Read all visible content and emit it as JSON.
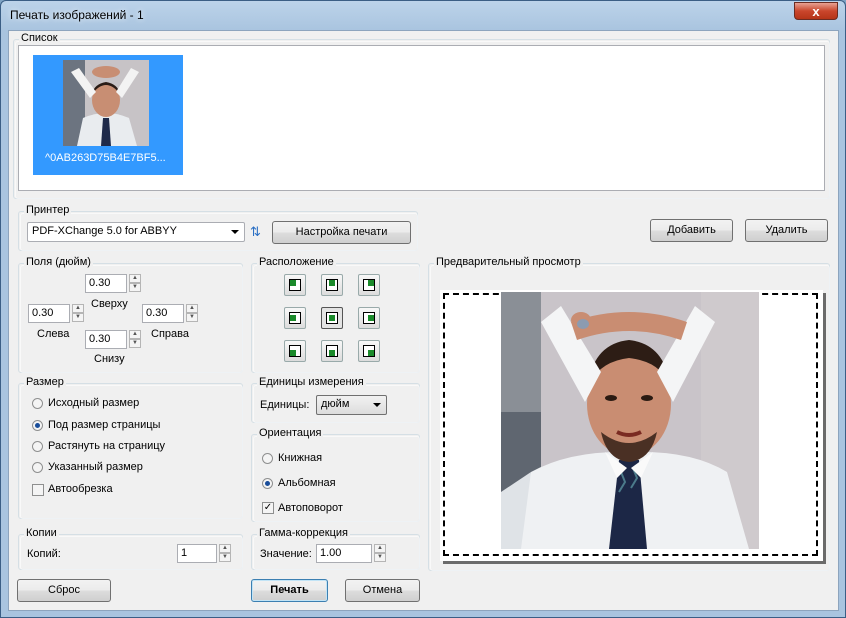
{
  "window": {
    "title": "Печать изображений - 1",
    "close_glyph": "x"
  },
  "list": {
    "legend": "Список",
    "items": [
      {
        "filename": "^0AB263D75B4E7BF5..."
      }
    ]
  },
  "printer": {
    "legend": "Принтер",
    "selected": "PDF-XChange 5.0 for ABBYY",
    "refresh_glyph": "⇅",
    "setup_button": "Настройка печати"
  },
  "actions": {
    "add_button": "Добавить",
    "delete_button": "Удалить"
  },
  "margins": {
    "legend": "Поля (дюйм)",
    "top_label": "Сверху",
    "top_value": "0.30",
    "left_label": "Слева",
    "left_value": "0.30",
    "right_label": "Справа",
    "right_value": "0.30",
    "bottom_label": "Снизу",
    "bottom_value": "0.30"
  },
  "position": {
    "legend": "Расположение",
    "selected": "center-center"
  },
  "preview": {
    "legend": "Предварительный просмотр"
  },
  "size": {
    "legend": "Размер",
    "options": [
      "Исходный размер",
      "Под размер страницы",
      "Растянуть на страницу",
      "Указанный размер"
    ],
    "selected_index": 1,
    "autocrop_label": "Автообрезка",
    "autocrop_checked": false
  },
  "units": {
    "legend": "Единицы измерения",
    "label": "Единицы:",
    "value": "дюйм"
  },
  "orientation": {
    "legend": "Ориентация",
    "portrait_label": "Книжная",
    "landscape_label": "Альбомная",
    "selected": "landscape",
    "autorotate_label": "Автоповорот",
    "autorotate_checked": true
  },
  "copies": {
    "legend": "Копии",
    "label": "Копий:",
    "value": "1"
  },
  "gamma": {
    "legend": "Гамма-коррекция",
    "label": "Значение:",
    "value": "1.00"
  },
  "footer": {
    "reset_button": "Сброс",
    "print_button": "Печать",
    "cancel_button": "Отмена"
  },
  "colors": {
    "selection": "#3399ff",
    "titlebar": "#a9c4df",
    "close": "#c9462c",
    "dialog_bg": "#f0f0f0"
  },
  "check_glyph": "✓",
  "spin_up_glyph": "▲",
  "spin_down_glyph": "▼"
}
